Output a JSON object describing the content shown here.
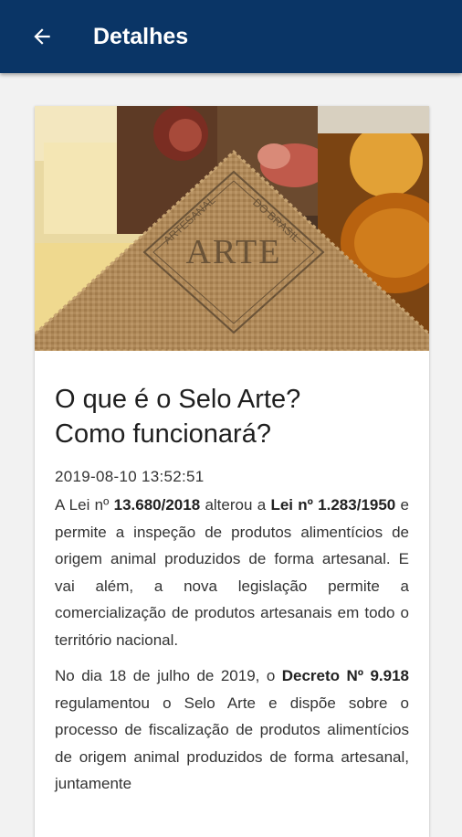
{
  "appbar": {
    "title": "Detalhes",
    "back_icon": "arrow-left-icon",
    "background": "#0a3566"
  },
  "hero": {
    "seal_word": "ARTE",
    "seal_top_left": "ARTESANAL",
    "seal_top_right": "DO BRASIL"
  },
  "article": {
    "title_line1": "O que é o Selo Arte?",
    "title_line2": "Como funcionará?",
    "date": "2019-08-10 13:52:51",
    "p1": {
      "t1": "A Lei nº ",
      "b1": "13.680/2018",
      "t2": " alterou a ",
      "b2": "Lei nº 1.283/1950",
      "t3": " e permite a inspeção de produtos alimentícios de origem animal produzidos de forma artesanal. E vai além, a nova legislação permite a comercialização de produtos artesanais em todo o território nacional."
    },
    "p2": {
      "t1": "No dia 18 de julho de 2019, o ",
      "b1": "Decreto Nº 9.918",
      "t2": " regulamentou o Selo Arte e dispõe sobre o processo de fiscalização de produtos alimentícios de origem animal produzidos de forma artesanal, juntamente"
    }
  }
}
